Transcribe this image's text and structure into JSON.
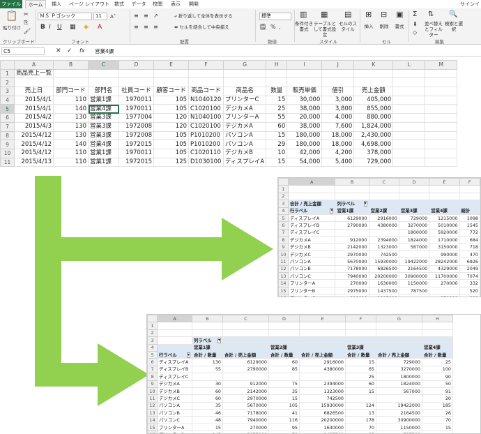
{
  "tabs": [
    "ファイル",
    "ホーム",
    "挿入",
    "ページ レイアウト",
    "数式",
    "データ",
    "校閲",
    "表示",
    "開発"
  ],
  "signin": "サインイ",
  "ribbon": {
    "paste": "貼り付け",
    "clipboard": "クリップボード",
    "font_name": "ＭＳ Ｐゴシック",
    "font_size": "11",
    "font_group": "フォント",
    "wrap": "折り返して全体を表示する",
    "merge": "セルを結合して中央揃え",
    "align_group": "配置",
    "number_format": "標準",
    "number_group": "数値",
    "cond_format": "条件付き書式",
    "table_format": "テーブルとして書式設定",
    "cell_style": "セルのスタイル",
    "style_group": "スタイル",
    "insert": "挿入",
    "delete": "削除",
    "format": "書式",
    "cell_group": "セル",
    "sort": "並べ替えとフィルター",
    "find": "検索と選択",
    "edit_group": "編集"
  },
  "formula_bar": {
    "name_box": "C5",
    "fx": "fx",
    "content": "営業4課"
  },
  "main_sheet": {
    "cols": [
      "A",
      "B",
      "C",
      "D",
      "E",
      "F",
      "G",
      "H",
      "I",
      "J",
      "K",
      "L",
      "M"
    ],
    "title": "商品売上一覧",
    "headers": [
      "売上日",
      "部門コード",
      "部門名",
      "社員コード",
      "顧客コード",
      "商品コード",
      "商品名",
      "数量",
      "販売単価",
      "値引",
      "売上金額"
    ],
    "rows": [
      [
        "2015/4/1",
        "110",
        "営業1課",
        "1970011",
        "105",
        "N1040120",
        "プリンターC",
        "15",
        "30,000",
        "3,000",
        "405,000"
      ],
      [
        "2015/4/1",
        "140",
        "営業4課",
        "1970011",
        "105",
        "C1020100",
        "デジカメA",
        "25",
        "38,000",
        "3,800",
        "855,000"
      ],
      [
        "2015/4/2",
        "130",
        "営業3課",
        "1977004",
        "120",
        "N1040100",
        "プリンターA",
        "55",
        "20,000",
        "4,000",
        "880,000"
      ],
      [
        "2015/4/3",
        "130",
        "営業3課",
        "1972008",
        "120",
        "C1020100",
        "デジカメA",
        "60",
        "38,000",
        "7,600",
        "1,824,000"
      ],
      [
        "2015/4/12",
        "130",
        "営業3課",
        "1972008",
        "105",
        "P1010200",
        "パソコンA",
        "15",
        "180,000",
        "18,000",
        "2,430,000"
      ],
      [
        "2015/4/12",
        "140",
        "営業4課",
        "1972015",
        "105",
        "P1010200",
        "パソコンA",
        "29",
        "180,000",
        "18,000",
        "4,698,000"
      ],
      [
        "2015/4/12",
        "110",
        "営業1課",
        "1970011",
        "105",
        "C1020110",
        "デジカメB",
        "10",
        "42,000",
        "4,200",
        "378,000"
      ],
      [
        "2015/4/13",
        "110",
        "営業1課",
        "1972015",
        "125",
        "D1030100",
        "ディスプレイA",
        "15",
        "54,000",
        "5,400",
        "729,000"
      ]
    ]
  },
  "pivot1": {
    "cols": [
      "A",
      "B",
      "C",
      "D",
      "E",
      "F"
    ],
    "value_label": "合計 / 売上金額",
    "col_label": "列ラベル",
    "row_label": "行ラベル",
    "depts": [
      "営業1課",
      "営業2課",
      "営業3課",
      "営業4課",
      "総計"
    ],
    "rows": [
      [
        "ディスプレイA",
        "6129000",
        "2916000",
        "729000",
        "1215000",
        "1098"
      ],
      [
        "ディスプレイB",
        "2790000",
        "4380000",
        "3270000",
        "5010000",
        "1545"
      ],
      [
        "ディスプレイC",
        "",
        "",
        "1800000",
        "5920000",
        "772"
      ],
      [
        "デジカメA",
        "912000",
        "2394000",
        "1824000",
        "1710000",
        "684"
      ],
      [
        "デジカメB",
        "2142000",
        "1323000",
        "567000",
        "3150000",
        "718"
      ],
      [
        "デジカメC",
        "2970000",
        "742500",
        "",
        "990000",
        "470"
      ],
      [
        "パソコンA",
        "5670000",
        "15930000",
        "19422000",
        "28242000",
        "6926"
      ],
      [
        "パソコンB",
        "7178000",
        "6826500",
        "2164500",
        "4329000",
        "2049"
      ],
      [
        "パソコンC",
        "7940000",
        "20200000",
        "30900000",
        "11700000",
        "7074"
      ],
      [
        "プリンターA",
        "270000",
        "1630000",
        "1150000",
        "270000",
        "332"
      ],
      [
        "プリンターB",
        "2975000",
        "1437500",
        "787500",
        "",
        "520"
      ],
      [
        "プリンターC",
        "810000",
        "1215000",
        "",
        "270000",
        "229"
      ]
    ],
    "total": [
      "総計",
      "39786000",
      "58994500",
      "62614000",
      "62806000",
      "22420"
    ]
  },
  "pivot2": {
    "cols": [
      "A",
      "B",
      "C",
      "D",
      "E",
      "F",
      "G",
      "H"
    ],
    "col_label": "列ラベル",
    "row_label": "行ラベル",
    "depts": [
      "営業1課",
      "営業2課",
      "営業3課",
      "営業4課"
    ],
    "sub": [
      "合計 / 数量",
      "合計 / 売上金額"
    ],
    "rows": [
      [
        "ディスプレイA",
        "130",
        "6129000",
        "60",
        "2916000",
        "15",
        "729000",
        "25"
      ],
      [
        "ディスプレイB",
        "55",
        "2790000",
        "85",
        "4380000",
        "65",
        "3270000",
        "100"
      ],
      [
        "ディスプレイC",
        "",
        "",
        "",
        "",
        "25",
        "1800000",
        "90"
      ],
      [
        "デジカメA",
        "30",
        "912000",
        "75",
        "2394000",
        "60",
        "1824000",
        "50"
      ],
      [
        "デジカメB",
        "60",
        "2142000",
        "35",
        "1323000",
        "15",
        "567000",
        "91"
      ],
      [
        "デジカメC",
        "60",
        "2970000",
        "15",
        "742500",
        "",
        "",
        "20"
      ],
      [
        "パソコンA",
        "35",
        "5670000",
        "105",
        "15930000",
        "124",
        "19422000",
        "185"
      ],
      [
        "パソコンB",
        "46",
        "7178000",
        "41",
        "6826500",
        "13",
        "2164500",
        "26"
      ],
      [
        "パソコンC",
        "48",
        "7940000",
        "116",
        "20200000",
        "178",
        "30900000",
        "70"
      ],
      [
        "プリンターA",
        "15",
        "270000",
        "95",
        "1630000",
        "70",
        "1150000",
        "15"
      ],
      [
        "プリンターB",
        "145",
        "2975000",
        "70",
        "1437500",
        "35",
        "787500",
        ""
      ],
      [
        "プリンターC",
        "30",
        "810000",
        "45",
        "1215000",
        "",
        "",
        "10"
      ]
    ],
    "total": [
      "総計",
      "654",
      "39786000",
      "742",
      "58994500",
      "600",
      "62614000",
      "682"
    ]
  },
  "colors": {
    "excel_green": "#217346",
    "arrow_green": "#92d050",
    "total_blue": "#dde8f5"
  }
}
